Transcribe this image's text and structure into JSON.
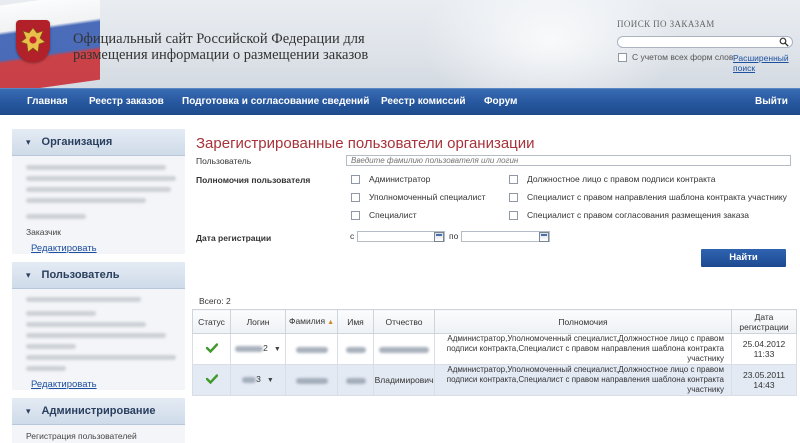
{
  "header": {
    "title": "Официальный сайт Российской Федерации для размещения информации о размещении заказов",
    "search_label": "ПОИСК ПО ЗАКАЗАМ",
    "search_placeholder": "",
    "all_forms_label": "С учетом всех форм слов",
    "advanced_search": "Расширенный поиск"
  },
  "nav": {
    "items": [
      {
        "label": "Главная"
      },
      {
        "label": "Реестр заказов"
      },
      {
        "label": "Подготовка и согласование сведений"
      },
      {
        "label": "-"
      },
      {
        "label": "Реестр комиссий"
      },
      {
        "label": "Форум"
      },
      {
        "label": "Выйти"
      }
    ]
  },
  "sidebar": {
    "org": {
      "title": "Организация",
      "role": "Заказчик",
      "edit_link": "Редактировать"
    },
    "user": {
      "title": "Пользователь",
      "edit_link": "Редактировать"
    },
    "admin": {
      "title": "Администрирование",
      "items": [
        "Регистрация пользователей"
      ]
    }
  },
  "main": {
    "title": "Зарегистрированные пользователи организации",
    "user_label": "Пользователь",
    "user_placeholder": "Введите фамилию пользователя или логин",
    "permissions_label": "Полномочия пользователя",
    "permissions": [
      "Администратор",
      "Должностное лицо с правом подписи контракта",
      "Уполномоченный специалист",
      "Специалист с правом направления шаблона контракта участнику",
      "Специалист",
      "Специалист с правом согласования размещения заказа"
    ],
    "reg_date_label": "Дата регистрации",
    "date_from_label": "с",
    "date_to_label": "по",
    "find_button": "Найти",
    "total": "Всего: 2"
  },
  "table": {
    "headers": [
      "Статус",
      "Логин",
      "Фамилия",
      "Имя",
      "Отчество",
      "Полномочия",
      "Дата регистрации"
    ],
    "rows": [
      {
        "login_suffix": "2",
        "patronymic": "",
        "permissions": "Администратор,Уполномоченный специалист,Должностное лицо с правом подписи контракта,Специалист с правом направления шаблона контракта участнику",
        "date": "25.04.2012 11:33"
      },
      {
        "login_suffix": "3",
        "patronymic": "Владимирович",
        "permissions": "Администратор,Уполномоченный специалист,Должностное лицо с правом подписи контракта,Специалист с правом направления шаблона контракта участнику",
        "date": "23.05.2011 14:43"
      }
    ]
  },
  "colors": {
    "nav_blue": "#2758a0",
    "title_red": "#a8323a",
    "link_blue": "#1e50a0",
    "status_green": "#3f9a2a"
  },
  "icons": {
    "emblem": "coat-of-arms-icon",
    "search": "magnifier-icon",
    "calendar": "calendar-icon",
    "status": "checkmark-icon"
  }
}
